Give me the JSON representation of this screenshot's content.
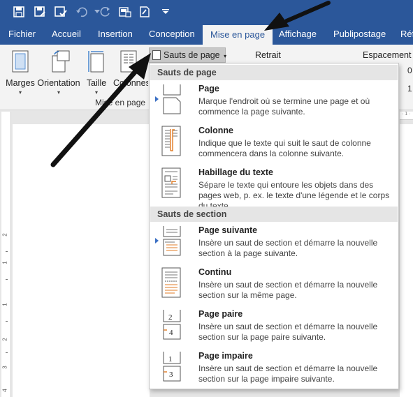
{
  "quick_access": {
    "icons": [
      "save-icon",
      "save-as-icon",
      "check-save-icon",
      "undo-icon",
      "redo-icon",
      "print-layout-icon",
      "form-icon",
      "customize-icon"
    ]
  },
  "tabs": [
    {
      "label": "Fichier"
    },
    {
      "label": "Accueil"
    },
    {
      "label": "Insertion"
    },
    {
      "label": "Conception"
    },
    {
      "label": "Mise en page",
      "active": true
    },
    {
      "label": "Affichage"
    },
    {
      "label": "Publipostage"
    },
    {
      "label": "Réf"
    }
  ],
  "ribbon": {
    "buttons": {
      "marges": "Marges",
      "orientation": "Orientation",
      "taille": "Taille",
      "colonnes": "Colonnes"
    },
    "sauts_label": "Sauts de page",
    "group_label": "Mise en page",
    "retrait": "Retrait",
    "espacement": "Espacement",
    "side_values": [
      "0",
      "1"
    ]
  },
  "menu": {
    "sections": [
      {
        "header": "Sauts de page",
        "items": [
          {
            "title": "Page",
            "desc": "Marque l'endroit où se termine une page et où commence la page suivante.",
            "icon": "page-break-icon"
          },
          {
            "title": "Colonne",
            "desc": "Indique que le texte qui suit le saut de colonne commencera dans la colonne suivante.",
            "icon": "column-break-icon"
          },
          {
            "title": "Habillage du texte",
            "desc": "Sépare le texte qui entoure les objets dans des pages web, p. ex. le texte d'une légende et le corps du texte.",
            "icon": "text-wrapping-icon"
          }
        ]
      },
      {
        "header": "Sauts de section",
        "items": [
          {
            "title": "Page suivante",
            "desc": "Insère un saut de section et démarre la nouvelle section à la page suivante.",
            "icon": "next-page-icon"
          },
          {
            "title": "Continu",
            "desc": "Insère un saut de section et démarre la nouvelle section sur la même page.",
            "icon": "continuous-icon"
          },
          {
            "title": "Page paire",
            "desc": "Insère un saut de section et démarre la nouvelle section sur la page paire suivante.",
            "icon": "even-page-icon",
            "numbers": [
              "2",
              "4"
            ]
          },
          {
            "title": "Page impaire",
            "desc": "Insère un saut de section et démarre la nouvelle section sur la page impaire suivante.",
            "icon": "odd-page-icon",
            "numbers": [
              "1",
              "3"
            ]
          }
        ]
      }
    ]
  },
  "ruler": {
    "numbers": [
      "2",
      "1",
      "1",
      "2",
      "3",
      "4"
    ],
    "corner": "L"
  },
  "colors": {
    "title_bar": "#2b579a",
    "ribbon_bg": "#f3f3f3",
    "accent": "#2b579a",
    "icon_orange": "#e07b24"
  }
}
